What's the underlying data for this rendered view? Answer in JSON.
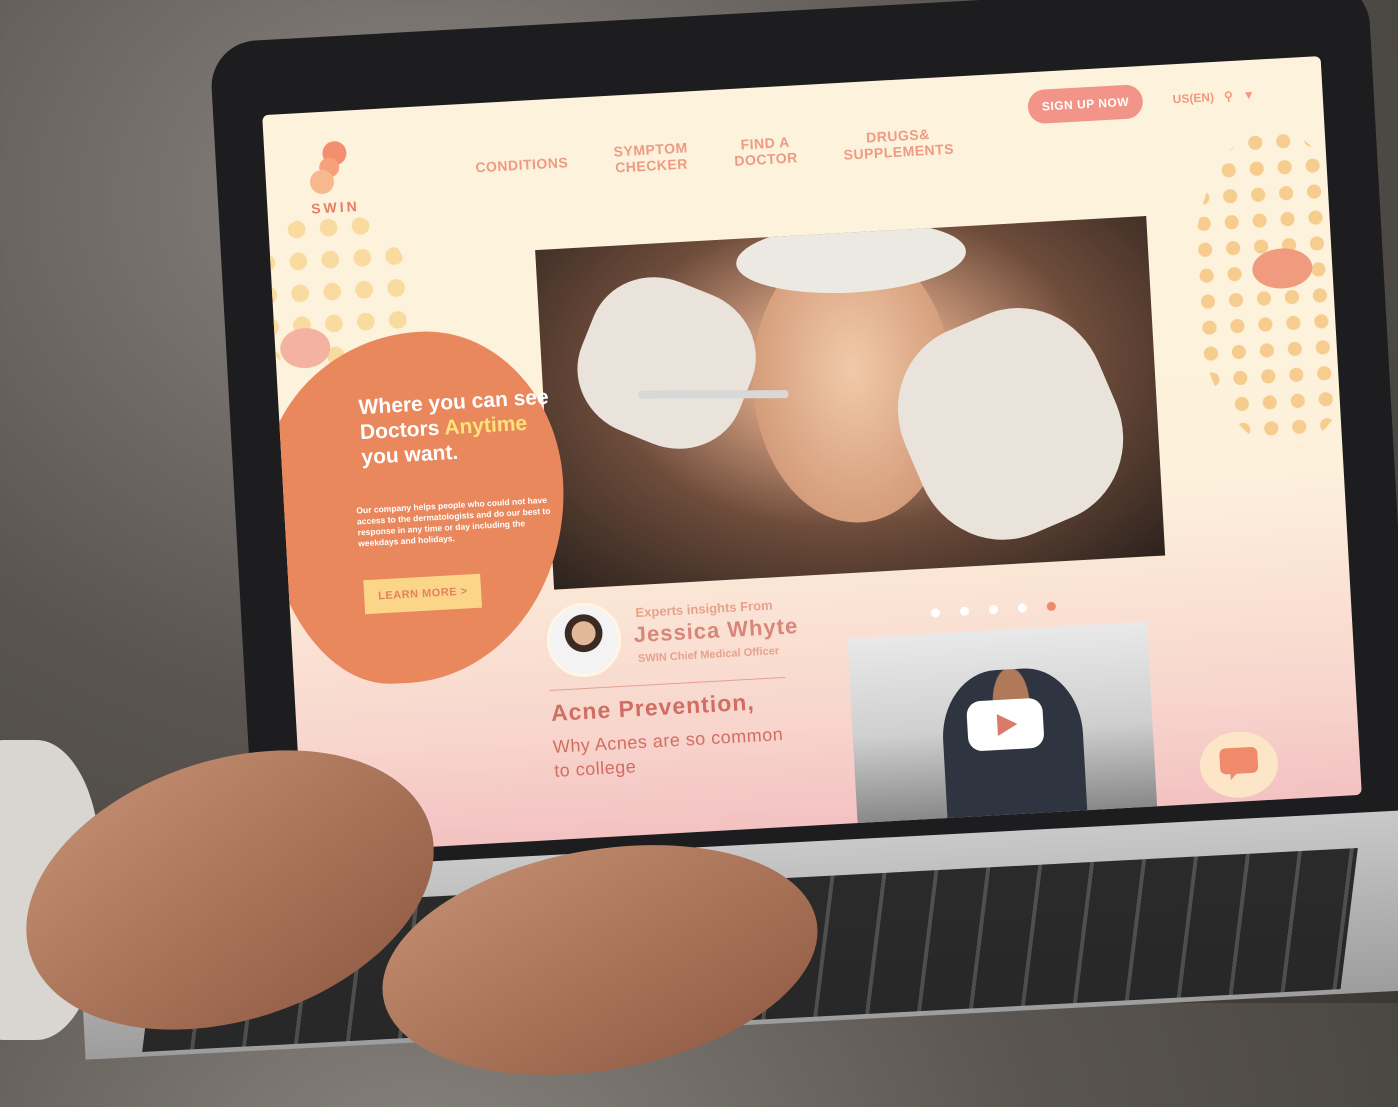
{
  "brand": {
    "logo_text": "SWIN"
  },
  "nav": {
    "items": [
      {
        "label": "CONDITIONS"
      },
      {
        "label": "SYMPTOM\nCHECKER"
      },
      {
        "label": "FIND A\nDOCTOR"
      },
      {
        "label": "DRUGS&\nSUPPLEMENTS"
      }
    ]
  },
  "header": {
    "signup_label": "SIGN UP NOW",
    "locale_label": "US(EN)"
  },
  "hero": {
    "title_a": "Where you can see Doctors ",
    "title_highlight": "Anytime",
    "title_b": " you want.",
    "description": "Our company helps people who could not have access to the dermatologists and do our best to response in any time or day including the weekdays and holidays.",
    "button_label": "LEARN MORE  >"
  },
  "expert": {
    "pre": "Experts insights From",
    "name": "Jessica Whyte",
    "role": "SWIN Chief Medical Officer"
  },
  "article": {
    "title": "Acne Prevention,",
    "subtitle": "Why Acnes are so common to  college"
  },
  "carousel": {
    "count": 5,
    "active_index": 4
  },
  "colors": {
    "accent": "#ef8a6b",
    "orange": "#e9875d",
    "yellow": "#fbd688",
    "cream": "#fdf3dc",
    "pink": "#f29487"
  }
}
